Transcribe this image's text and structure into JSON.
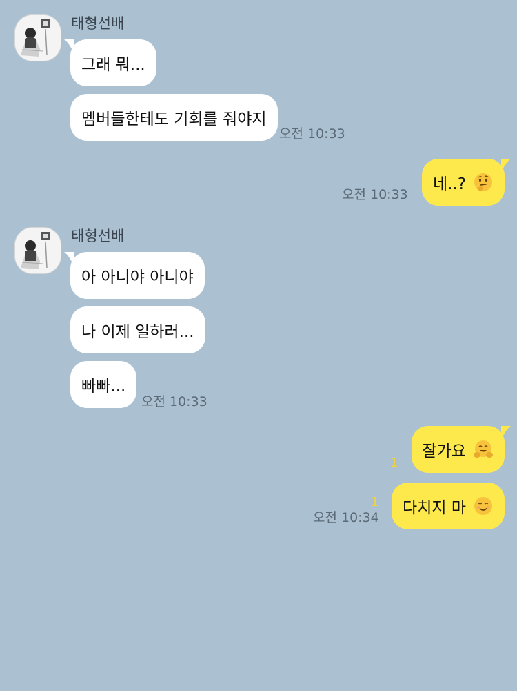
{
  "chat": {
    "groups": [
      {
        "sender": "태형선배",
        "messages": [
          "그래 뭐...",
          "멤버들한테도 기회를 줘야지"
        ],
        "time": "오전 10:33"
      },
      {
        "sender": "태형선배",
        "messages": [
          "아 아니야 아니야",
          "나 이제 일하러...",
          "빠빠..."
        ],
        "time": "오전 10:33"
      }
    ],
    "outgoing": [
      {
        "text": "네..?",
        "emoji": "thinking-face-emoji",
        "time": "오전 10:33",
        "unread": ""
      },
      {
        "text": "잘가요",
        "emoji": "hugging-face-emoji",
        "time": "",
        "unread": "1"
      },
      {
        "text": "다치지 마",
        "emoji": "smiling-face-emoji",
        "time": "오전 10:34",
        "unread": "1"
      }
    ]
  },
  "colors": {
    "background": "#abc1d1",
    "incoming_bubble": "#ffffff",
    "outgoing_bubble": "#fee94d",
    "unread_count": "#f2d43a"
  }
}
